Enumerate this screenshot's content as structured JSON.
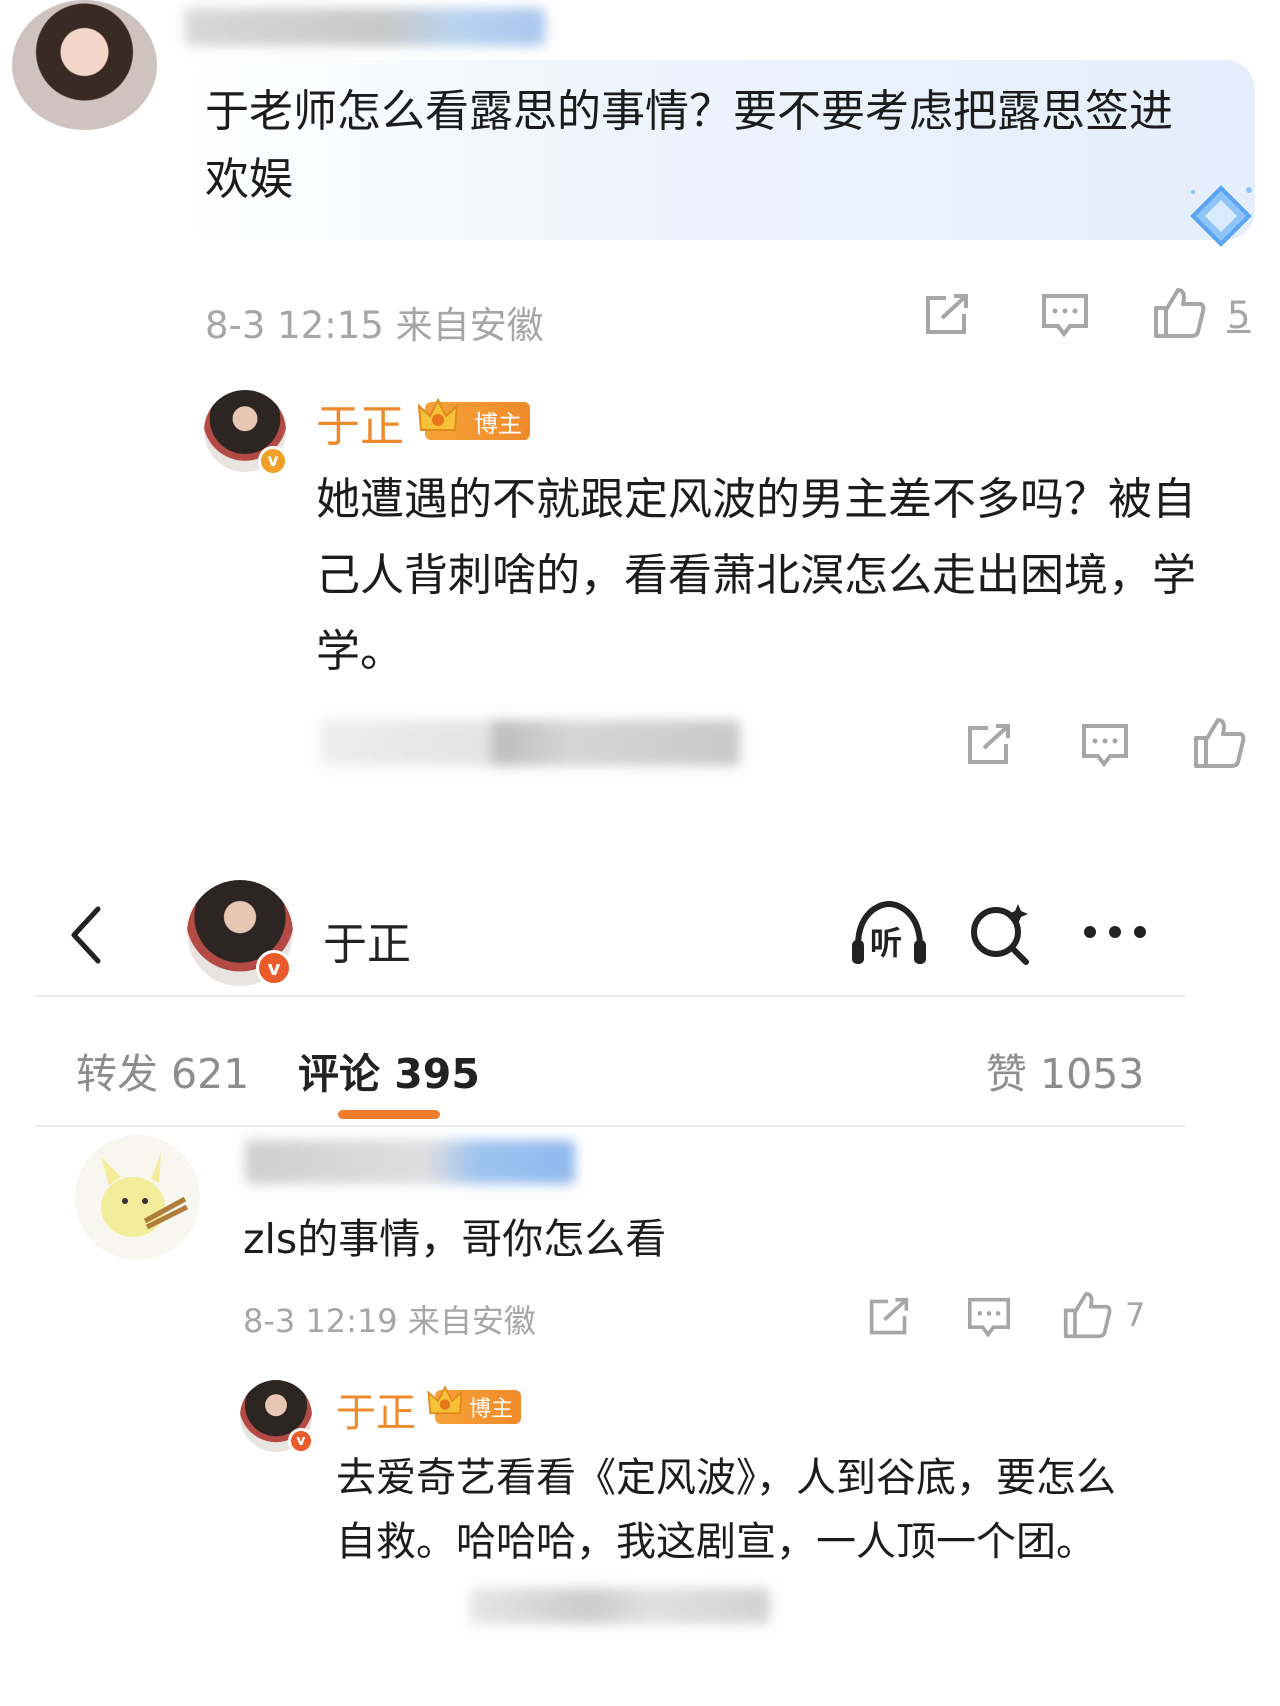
{
  "comment1": {
    "text": "于老师怎么看露思的事情？要不要考虑把露思签进欢娱",
    "meta": "8-3 12:15 来自安徽",
    "like_count": "5",
    "icons": [
      "share-icon",
      "comment-icon",
      "like-icon"
    ]
  },
  "reply1": {
    "author": "于正",
    "badge": "博主",
    "text": "她遭遇的不就跟定风波的男主差不多吗？被自己人背刺啥的，看看萧北溟怎么走出困境，学学。"
  },
  "header": {
    "name": "于正",
    "listen_label": "听",
    "icons": [
      "back-icon",
      "listen-icon",
      "search-icon",
      "more-icon"
    ]
  },
  "tabs": {
    "repost": "转发 621",
    "comments": "评论 395",
    "likes": "赞 1053"
  },
  "comment2": {
    "text": "zls的事情，哥你怎么看",
    "meta": "8-3 12:19 来自安徽",
    "like_count": "7"
  },
  "reply2": {
    "author": "于正",
    "badge": "博主",
    "text": "去爱奇艺看看《定风波》，人到谷底，要怎么自救。哈哈哈，我这剧宣，一人顶一个团。"
  },
  "colors": {
    "accent_orange": "#ef8a2c",
    "tab_underline": "#f07d2b",
    "meta_gray": "#a6a6a6"
  }
}
